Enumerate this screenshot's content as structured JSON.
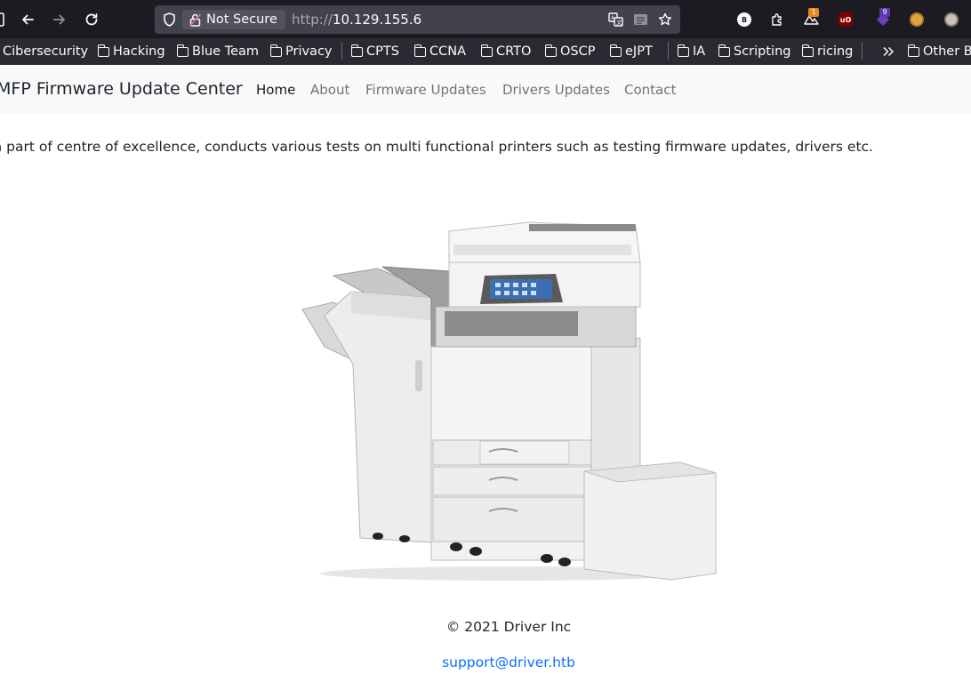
{
  "browser": {
    "security_label": "Not Secure",
    "url_scheme": "http://",
    "url_host": "10.129.155.6",
    "extensions": {
      "ext_b_label": "B",
      "ext_clipper_badge": "1",
      "ext_ublock_label": "uO",
      "ext_purple_badge": "9"
    },
    "bookmarks": [
      {
        "label": "Cibersecurity"
      },
      {
        "label": "Hacking"
      },
      {
        "label": "Blue Team"
      },
      {
        "label": "Privacy"
      },
      {
        "label": "CPTS"
      },
      {
        "label": "CCNA"
      },
      {
        "label": "CRTO"
      },
      {
        "label": "OSCP"
      },
      {
        "label": "eJPT"
      },
      {
        "label": "IA"
      },
      {
        "label": "Scripting"
      },
      {
        "label": "ricing"
      },
      {
        "label": "Other B"
      }
    ]
  },
  "site": {
    "brand": "MFP Firmware Update Center",
    "nav": [
      {
        "label": "Home"
      },
      {
        "label": "About"
      },
      {
        "label": "Firmware Updates"
      },
      {
        "label": "Drivers Updates"
      },
      {
        "label": "Contact"
      }
    ],
    "intro": "Our Team as a part of centre of excellence, conducts various tests on multi functional printers such as testing firmware updates, drivers etc.",
    "footer_copyright": "© 2021 Driver Inc",
    "footer_email": "support@driver.htb"
  },
  "colors": {
    "toolbar_bg": "#1c1b22",
    "bookmarks_bg": "#2b2a33",
    "navbar_bg": "#f8f9fa",
    "link_color": "#0d6efd"
  }
}
